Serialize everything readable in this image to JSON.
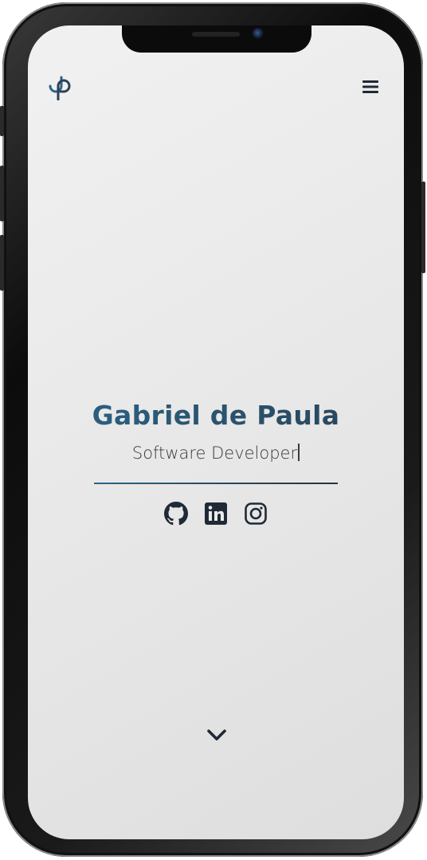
{
  "header": {
    "logo_icon": "dp-monogram-logo",
    "menu_icon": "hamburger-menu-icon"
  },
  "hero": {
    "name": "Gabriel de Paula",
    "role": "Software Developer"
  },
  "socials": [
    {
      "icon": "github-icon"
    },
    {
      "icon": "linkedin-icon"
    },
    {
      "icon": "instagram-icon"
    }
  ],
  "scroll": {
    "icon": "chevron-down-icon"
  },
  "colors": {
    "accent": "#2b6587",
    "dark": "#1f2a36",
    "screen_bg": "#ebebeb"
  }
}
